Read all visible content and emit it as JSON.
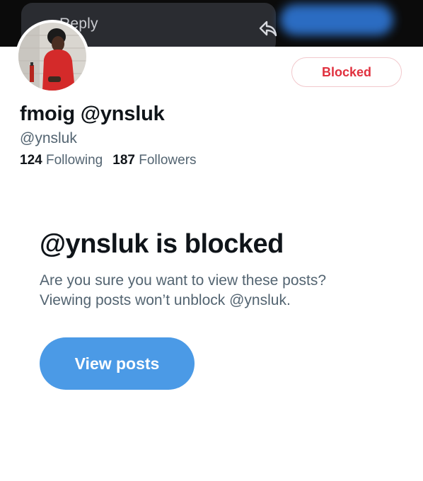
{
  "header": {
    "reply_label": "Reply",
    "reply_icon": "reply-arrow-icon"
  },
  "profile": {
    "display_name": "fmoig @ynsluk",
    "handle": "@ynsluk",
    "following_count": "124",
    "following_label": "Following",
    "followers_count": "187",
    "followers_label": "Followers",
    "blocked_button_label": "Blocked"
  },
  "blocked_notice": {
    "title": "@ynsluk is blocked",
    "line1": "Are you sure you want to view these posts?",
    "line2": "Viewing posts won’t unblock @ynsluk.",
    "view_posts_label": "View posts"
  },
  "colors": {
    "accent": "#4b9ae6",
    "blocked_red": "#e0303e",
    "text_primary": "#0f1419",
    "text_secondary": "#536471"
  }
}
